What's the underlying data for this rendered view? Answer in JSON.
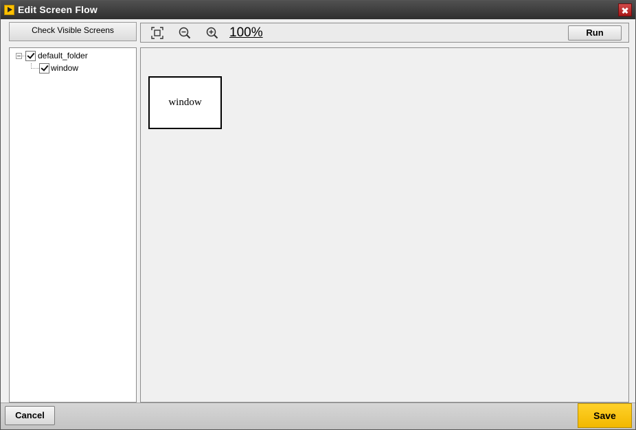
{
  "window": {
    "title": "Edit Screen Flow",
    "app_icon": "play-icon",
    "close_icon": "close-icon"
  },
  "left_panel": {
    "check_visible_label": "Check Visible Screens",
    "tree": {
      "folder": {
        "label": "default_folder",
        "checked": true,
        "expanded": true
      },
      "children": [
        {
          "label": "window",
          "checked": true
        }
      ]
    }
  },
  "toolbar": {
    "fit_icon": "fit-screen-icon",
    "zoom_out_icon": "zoom-out-icon",
    "zoom_in_icon": "zoom-in-icon",
    "zoom_level": "100%",
    "run_label": "Run"
  },
  "canvas": {
    "nodes": [
      {
        "label": "window"
      }
    ]
  },
  "footer": {
    "cancel_label": "Cancel",
    "save_label": "Save"
  },
  "colors": {
    "titlebar": "#3a3a3a",
    "close": "#c0282a",
    "save_accent": "#ffc20e",
    "canvas_bg": "#f0f0f0"
  }
}
